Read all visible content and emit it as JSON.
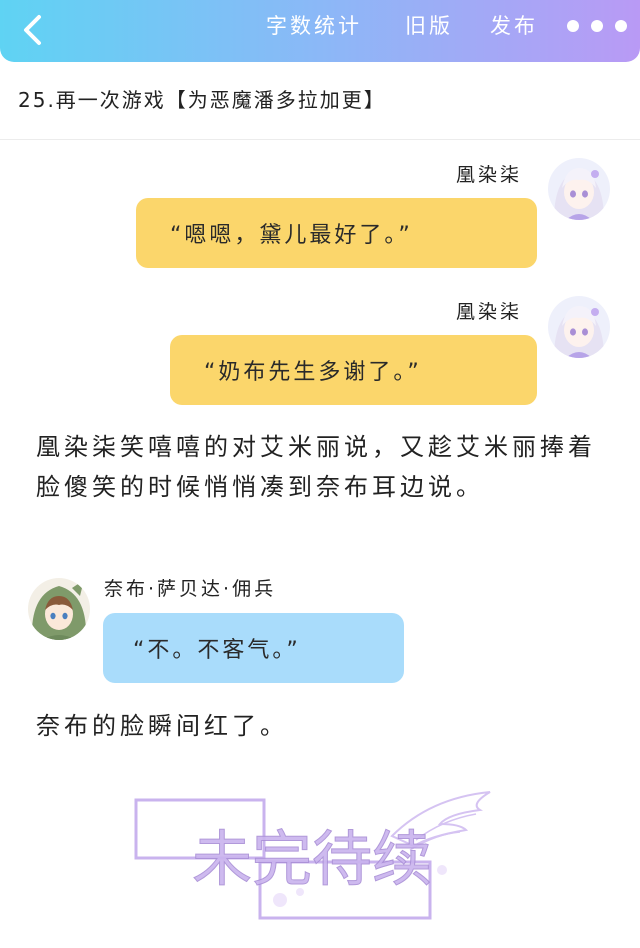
{
  "header": {
    "back_icon": "chevron-left-icon",
    "word_count": "字数统计",
    "old_version": "旧版",
    "publish": "发布",
    "more_icon": "more-dots-icon"
  },
  "chapter": {
    "title": "25.再一次游戏【为恶魔潘多拉加更】"
  },
  "messages": [
    {
      "speaker": "凰染柒",
      "text": "“嗯嗯，黛儿最好了。”"
    },
    {
      "speaker": "凰染柒",
      "text": "“奶布先生多谢了。”"
    },
    {
      "speaker": "奈布·萨贝达·佣兵",
      "text": "“不。不客气。”"
    }
  ],
  "narration": [
    "凰染柒笑嘻嘻的对艾米丽说，又趁艾米丽捧着脸傻笑的时候悄悄凑到奈布耳边说。",
    "奈布的脸瞬间红了。"
  ],
  "stamp": {
    "text": "未完待续"
  },
  "colors": {
    "header_start": "#5fd3f3",
    "header_end": "#b99af5",
    "bubble_yellow": "#fbd66b",
    "bubble_blue": "#a9dcfb",
    "stamp_purple": "#c9b3ee"
  }
}
